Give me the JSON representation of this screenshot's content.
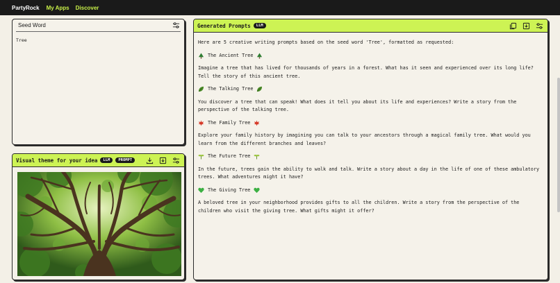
{
  "nav": {
    "brand": "PartyRock",
    "my_apps": "My Apps",
    "discover": "Discover"
  },
  "seed": {
    "title": "Seed Word",
    "value": "Tree"
  },
  "visual": {
    "title": "Visual theme for your idea",
    "badge_llm": "LLM",
    "badge_prompt": "PROMPT"
  },
  "prompts": {
    "title": "Generated Prompts",
    "badge_llm": "LLM",
    "intro": "Here are 5 creative writing prompts based on the seed word 'Tree', formatted as requested:",
    "items": [
      {
        "heading": "The Ancient Tree",
        "icon": "evergreen-tree-icon",
        "body": "Imagine a tree that has lived for thousands of years in a forest. What has it seen and experienced over its long life? Tell the story of this ancient tree."
      },
      {
        "heading": "The Talking Tree",
        "icon": "leaf-icon",
        "body": "You discover a tree that can speak! What does it tell you about its life and experiences? Write a story from the perspective of the talking tree."
      },
      {
        "heading": "The Family Tree",
        "icon": "maple-leaf-icon",
        "body": "Explore your family history by imagining you can talk to your ancestors through a magical family tree. What would you learn from the different branches and leaves?"
      },
      {
        "heading": "The Future Tree",
        "icon": "seedling-icon",
        "body": "In the future, trees gain the ability to walk and talk. Write a story about a day in the life of one of these ambulatory trees. What adventures might it have?"
      },
      {
        "heading": "The Giving Tree",
        "icon": "green-heart-icon",
        "body": "A beloved tree in your neighborhood provides gifts to all the children. Write a story from the perspective of the children who visit the giving tree. What gifts might it offer?"
      }
    ]
  },
  "colors": {
    "accent": "#cdf354",
    "topbar": "#1a1a1a",
    "background": "#f3f0e7"
  }
}
